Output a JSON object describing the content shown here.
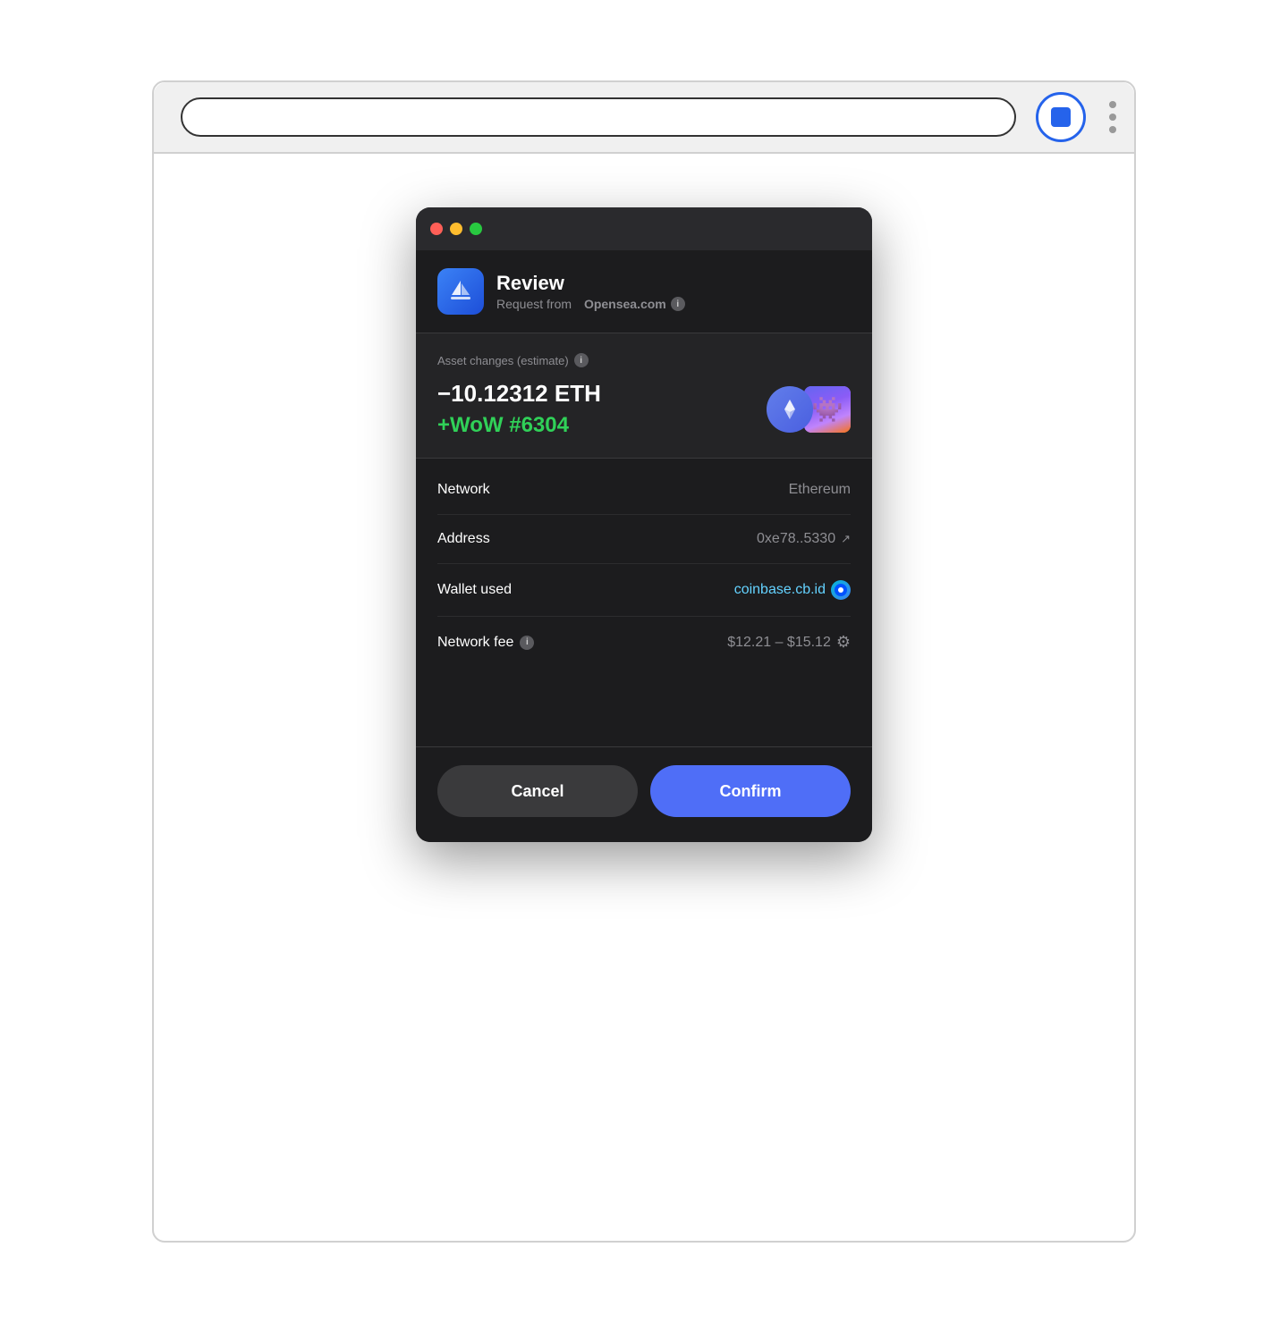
{
  "browser": {
    "record_button_label": "record"
  },
  "popup": {
    "titlebar": {
      "dots": [
        "red",
        "yellow",
        "green"
      ]
    },
    "header": {
      "title": "Review",
      "subtitle_prefix": "Request from",
      "source": "Opensea.com"
    },
    "asset_section": {
      "label": "Asset changes (estimate)",
      "eth_amount": "−10.12312 ETH",
      "nft_amount": "+WoW #6304"
    },
    "details": [
      {
        "label": "Network",
        "value": "Ethereum",
        "type": "text"
      },
      {
        "label": "Address",
        "value": "0xe78..5330",
        "type": "address"
      },
      {
        "label": "Wallet used",
        "value": "coinbase.cb.id",
        "type": "wallet"
      },
      {
        "label": "Network fee",
        "value": "$12.21 – $15.12",
        "type": "fee"
      }
    ],
    "footer": {
      "cancel_label": "Cancel",
      "confirm_label": "Confirm"
    }
  }
}
